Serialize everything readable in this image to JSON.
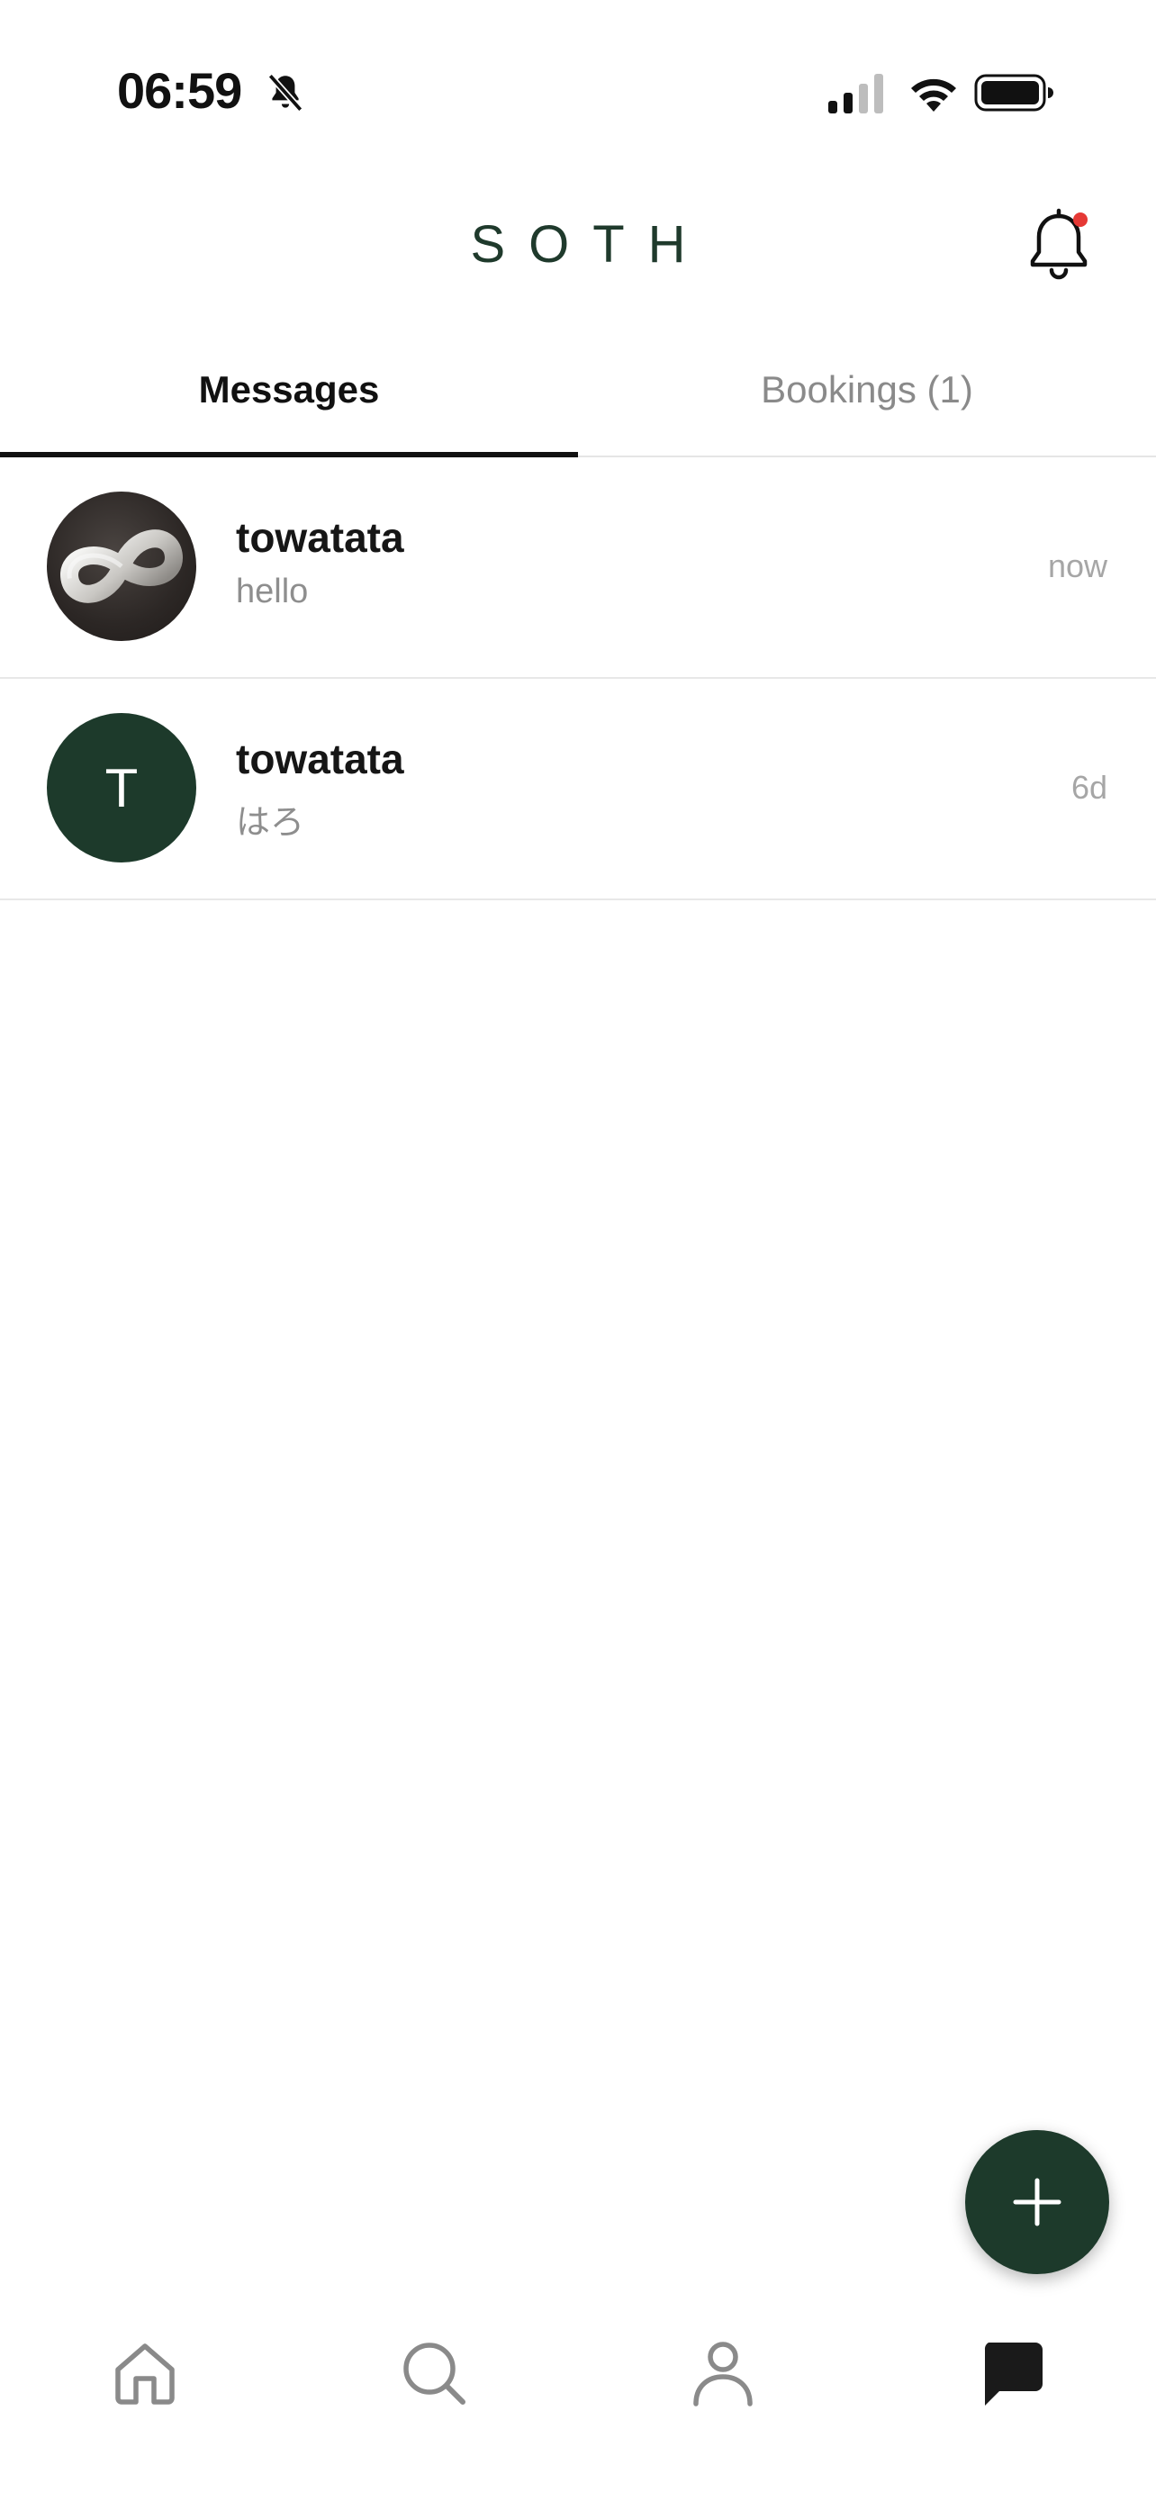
{
  "status_bar": {
    "time": "06:59",
    "icons": [
      "bell-slash-icon",
      "cellular-signal-icon",
      "wifi-icon",
      "battery-icon"
    ]
  },
  "header": {
    "brand": "SOTH",
    "notification_icon": "bell-icon",
    "has_unread_notification": true
  },
  "tabs": [
    {
      "label": "Messages",
      "active": true
    },
    {
      "label": "Bookings (1)",
      "active": false
    }
  ],
  "conversations": [
    {
      "name": "towatata",
      "preview": "hello",
      "time": "now",
      "avatar": "photo"
    },
    {
      "name": "towatata",
      "preview": "はろ",
      "time": "6d",
      "avatar": "letter",
      "avatar_letter": "T"
    }
  ],
  "fab": {
    "icon": "plus-icon"
  },
  "bottom_nav": [
    {
      "icon": "home-icon",
      "active": false
    },
    {
      "icon": "search-icon",
      "active": false
    },
    {
      "icon": "profile-icon",
      "active": false
    },
    {
      "icon": "chat-icon",
      "active": true
    }
  ],
  "colors": {
    "brand_green": "#1d3a2b",
    "notification_dot": "#e53935",
    "inactive_text": "#8a8a8a",
    "active_text": "#111111"
  }
}
